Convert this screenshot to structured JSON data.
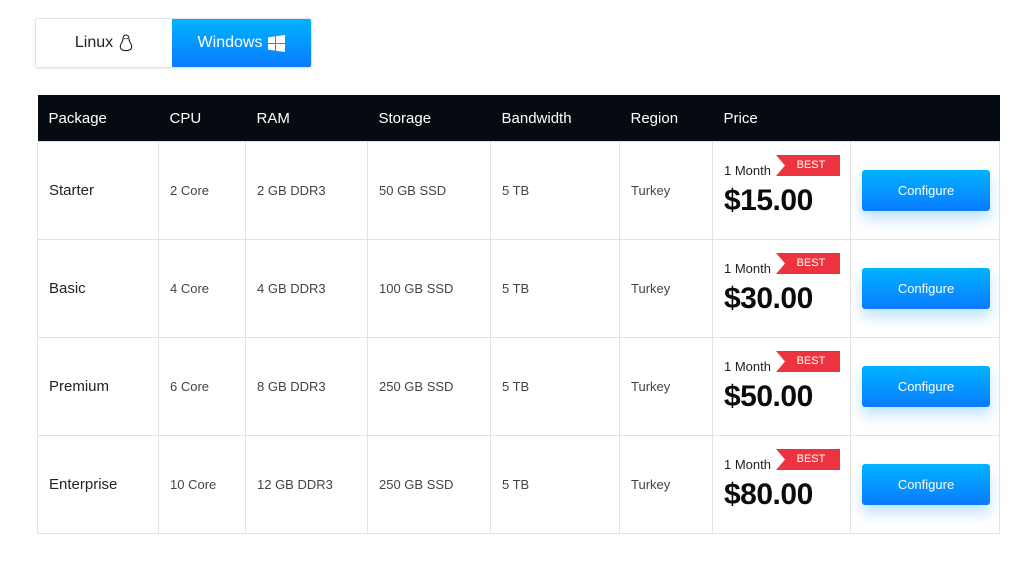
{
  "os_toggle": {
    "options": [
      {
        "label": "Linux",
        "icon": "linux-penguin-icon",
        "active": false
      },
      {
        "label": "Windows",
        "icon": "windows-logo-icon",
        "active": true
      }
    ]
  },
  "table": {
    "headers": [
      "Package",
      "CPU",
      "RAM",
      "Storage",
      "Bandwidth",
      "Region",
      "Price",
      ""
    ],
    "rows": [
      {
        "package": "Starter",
        "cpu": "2 Core",
        "ram": "2 GB DDR3",
        "storage": "50 GB SSD",
        "bandwidth": "5 TB",
        "region": "Turkey",
        "period": "1 Month",
        "badge": "BEST",
        "price": "$15.00",
        "action": "Configure"
      },
      {
        "package": "Basic",
        "cpu": "4 Core",
        "ram": "4 GB DDR3",
        "storage": "100 GB SSD",
        "bandwidth": "5 TB",
        "region": "Turkey",
        "period": "1 Month",
        "badge": "BEST",
        "price": "$30.00",
        "action": "Configure"
      },
      {
        "package": "Premium",
        "cpu": "6 Core",
        "ram": "8 GB DDR3",
        "storage": "250 GB SSD",
        "bandwidth": "5 TB",
        "region": "Turkey",
        "period": "1 Month",
        "badge": "BEST",
        "price": "$50.00",
        "action": "Configure"
      },
      {
        "package": "Enterprise",
        "cpu": "10 Core",
        "ram": "12 GB DDR3",
        "storage": "250 GB SSD",
        "bandwidth": "5 TB",
        "region": "Turkey",
        "period": "1 Month",
        "badge": "BEST",
        "price": "$80.00",
        "action": "Configure"
      }
    ]
  },
  "colors": {
    "accent": "#0a7bff",
    "header_bg": "#050b11",
    "badge": "#ee3340"
  }
}
